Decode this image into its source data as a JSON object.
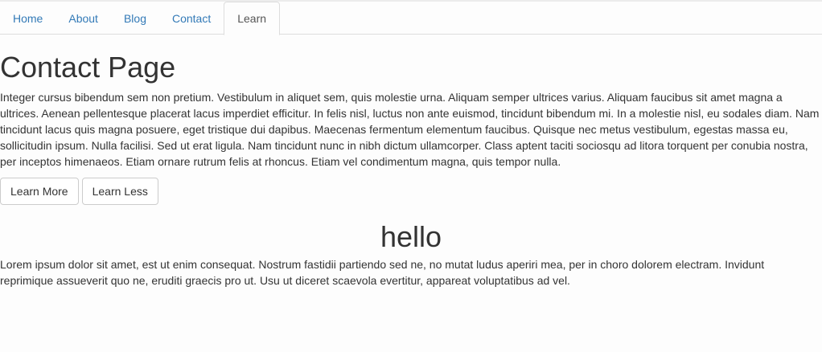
{
  "nav": {
    "tabs": [
      {
        "label": "Home"
      },
      {
        "label": "About"
      },
      {
        "label": "Blog"
      },
      {
        "label": "Contact"
      },
      {
        "label": "Learn"
      }
    ],
    "active_tab": "Learn"
  },
  "page": {
    "title": "Contact Page",
    "body": "Integer cursus bibendum sem non pretium. Vestibulum in aliquet sem, quis molestie urna. Aliquam semper ultrices varius. Aliquam faucibus sit amet magna a ultrices. Aenean pellentesque placerat lacus imperdiet efficitur. In felis nisl, luctus non ante euismod, tincidunt bibendum mi. In a molestie nisl, eu sodales diam. Nam tincidunt lacus quis magna posuere, eget tristique dui dapibus. Maecenas fermentum elementum faucibus. Quisque nec metus vestibulum, egestas massa eu, sollicitudin ipsum. Nulla facilisi. Sed ut erat ligula. Nam tincidunt nunc in nibh dictum ullamcorper. Class aptent taciti sociosqu ad litora torquent per conubia nostra, per inceptos himenaeos. Etiam ornare rutrum felis at rhoncus. Etiam vel condimentum magna, quis tempor nulla.",
    "learn_more_label": "Learn More",
    "learn_less_label": "Learn Less",
    "section_heading": "hello",
    "section_text": "Lorem ipsum dolor sit amet, est ut enim consequat. Nostrum fastidii partiendo sed ne, no mutat ludus aperiri mea, per in choro dolorem electram. Invidunt reprimique assueverit quo ne, eruditi graecis pro ut. Usu ut diceret scaevola evertitur, appareat voluptatibus ad vel."
  },
  "colors": {
    "link": "#337ab7",
    "text": "#333333",
    "border": "#dddddd"
  }
}
